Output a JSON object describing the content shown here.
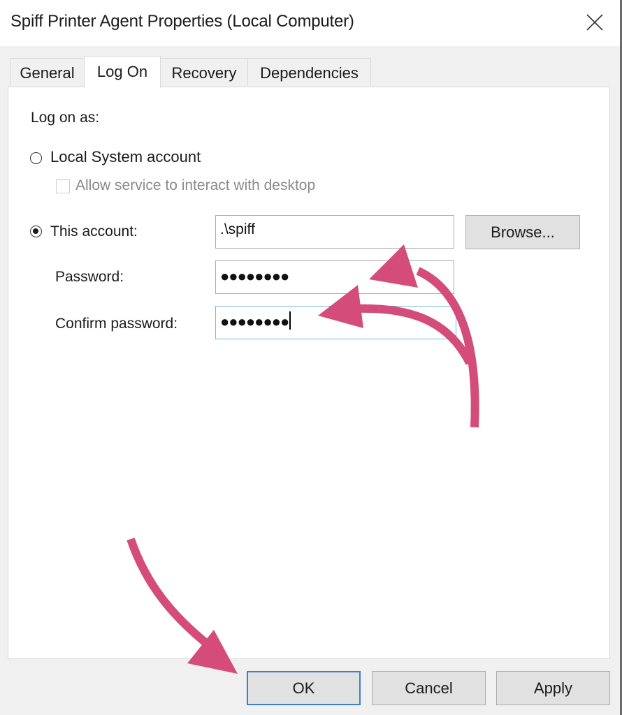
{
  "window": {
    "title": "Spiff Printer Agent Properties (Local Computer)",
    "close_icon": "close-x-icon"
  },
  "tabs": [
    {
      "label": "General",
      "active": false
    },
    {
      "label": "Log On",
      "active": true
    },
    {
      "label": "Recovery",
      "active": false
    },
    {
      "label": "Dependencies",
      "active": false
    }
  ],
  "logon": {
    "heading": "Log on as:",
    "local_system": {
      "label": "Local System account",
      "selected": false
    },
    "allow_desktop": {
      "label": "Allow service to interact with desktop",
      "checked": false,
      "enabled": false
    },
    "this_account": {
      "label": "This account:",
      "selected": true,
      "value": ".\\spiff"
    },
    "browse_label": "Browse...",
    "password": {
      "label": "Password:",
      "masked_value": "●●●●●●●●"
    },
    "confirm_password": {
      "label": "Confirm password:",
      "masked_value": "●●●●●●●●",
      "focused": true
    }
  },
  "footer": {
    "ok_label": "OK",
    "cancel_label": "Cancel",
    "apply_label": "Apply"
  },
  "annotations": {
    "arrow_color": "#d44d7a",
    "arrows": [
      "curved arrow pointing to This account field",
      "curved arrow pointing to Confirm password field",
      "curved arrow pointing to OK button"
    ]
  }
}
